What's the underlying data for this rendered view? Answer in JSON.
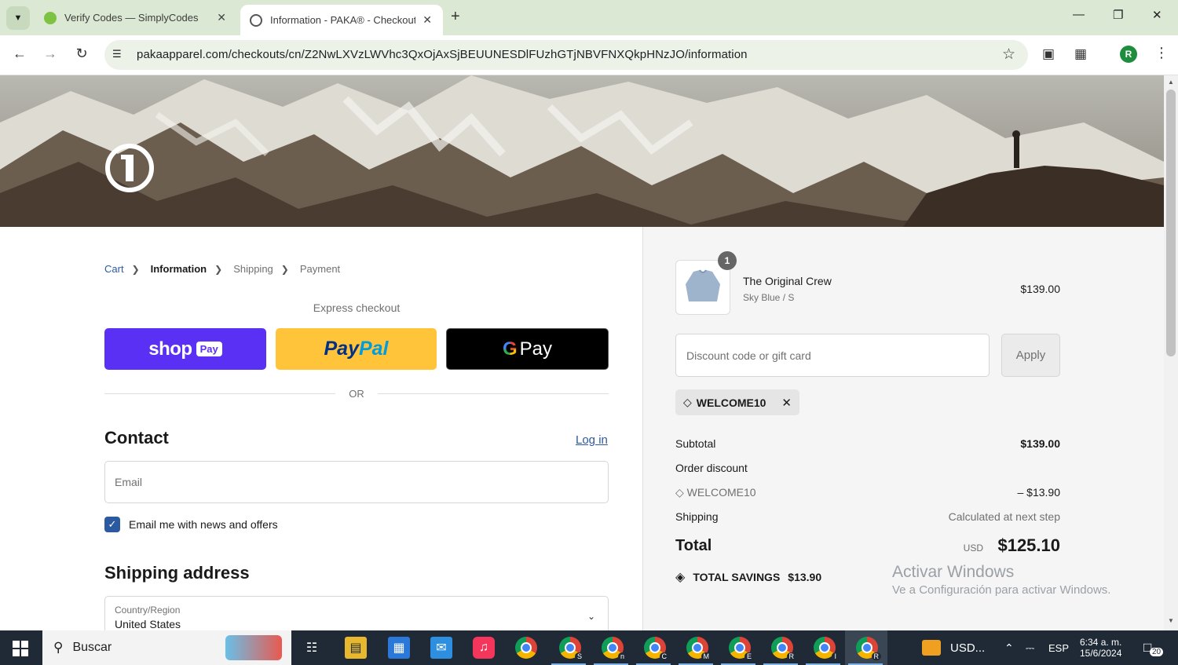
{
  "browser": {
    "tabs": [
      {
        "title": "Verify Codes — SimplyCodes"
      },
      {
        "title": "Information - PAKA® - Checkout"
      }
    ],
    "url": "pakaapparel.com/checkouts/cn/Z2NwLXVzLWVhc3QxOjAxSjBEUUNESDlFUzhGTjNBVFNXQkpHNzJO/information",
    "profile_initial": "R"
  },
  "checkout": {
    "breadcrumbs": [
      "Cart",
      "Information",
      "Shipping",
      "Payment"
    ],
    "express_label": "Express checkout",
    "express_buttons": {
      "shop": "shop",
      "shop_pay": "Pay",
      "paypal_a": "Pay",
      "paypal_b": "Pal",
      "gpay": "Pay"
    },
    "or_label": "OR",
    "contact": {
      "heading": "Contact",
      "login_link": "Log in",
      "email_placeholder": "Email",
      "newsletter_label": "Email me with news and offers",
      "newsletter_checked": true
    },
    "shipping": {
      "heading": "Shipping address",
      "country_label": "Country/Region",
      "country_value": "United States"
    }
  },
  "summary": {
    "item": {
      "name": "The Original Crew",
      "variant": "Sky Blue / S",
      "price": "$139.00",
      "quantity": "1"
    },
    "discount_placeholder": "Discount code or gift card",
    "apply_label": "Apply",
    "applied_code": "WELCOME10",
    "subtotal_label": "Subtotal",
    "subtotal_value": "$139.00",
    "order_discount_label": "Order discount",
    "discount_code": "WELCOME10",
    "discount_value": "– $13.90",
    "shipping_label": "Shipping",
    "shipping_value": "Calculated at next step",
    "total_label": "Total",
    "total_currency": "USD",
    "total_value": "$125.10",
    "savings_label": "TOTAL SAVINGS",
    "savings_value": "$13.90"
  },
  "watermark": {
    "line1": "Activar Windows",
    "line2": "Ve a Configuración para activar Windows."
  },
  "taskbar": {
    "search_text": "Buscar",
    "weather_text": "USD...",
    "language": "ESP",
    "time": "6:34 a. m.",
    "date": "15/6/2024",
    "notifications": "20",
    "chrome_profiles": [
      "S",
      "n",
      "C",
      "M",
      "E",
      "R",
      "I",
      "R"
    ]
  },
  "colors": {
    "shop_pay": "#5a31f4",
    "paypal": "#ffc439",
    "link": "#2c5aa0",
    "tab_strip": "#dbe8d3"
  }
}
